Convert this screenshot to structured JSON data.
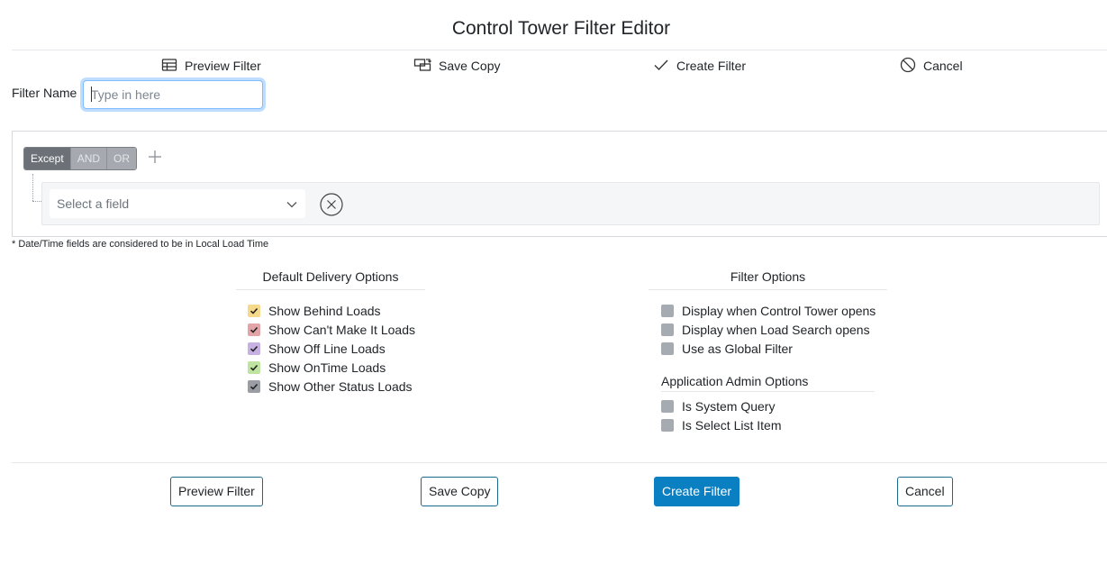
{
  "title": "Control Tower Filter Editor",
  "toolbar": {
    "preview": {
      "label": "Preview Filter",
      "icon": "table-icon"
    },
    "save_copy": {
      "label": "Save Copy",
      "icon": "copy-arrows-icon"
    },
    "create": {
      "label": "Create Filter",
      "icon": "checkmark-icon"
    },
    "cancel": {
      "label": "Cancel",
      "icon": "ban-icon"
    }
  },
  "filter_name": {
    "label": "Filter Name",
    "value": "",
    "placeholder": "Type in here"
  },
  "query_builder": {
    "group_buttons": [
      "Except",
      "AND",
      "OR"
    ],
    "active_group": "Except",
    "add_icon": "plus-icon",
    "rule": {
      "field_placeholder": "Select a field",
      "remove_icon": "circle-x-icon"
    }
  },
  "note": "* Date/Time fields are considered to be in Local Load Time",
  "delivery_options": {
    "title": "Default Delivery Options",
    "items": [
      {
        "label": "Show Behind Loads",
        "checked": true,
        "color": "#f6d98a"
      },
      {
        "label": "Show Can't Make It Loads",
        "checked": true,
        "color": "#e2a4a6"
      },
      {
        "label": "Show Off Line Loads",
        "checked": true,
        "color": "#c7b1e3"
      },
      {
        "label": "Show OnTime Loads",
        "checked": true,
        "color": "#bfe3a0"
      },
      {
        "label": "Show Other Status Loads",
        "checked": true,
        "color": "#9a9ea4"
      }
    ]
  },
  "filter_options": {
    "title": "Filter Options",
    "items": [
      {
        "label": "Display when Control Tower opens",
        "checked": false
      },
      {
        "label": "Display when Load Search opens",
        "checked": false
      },
      {
        "label": "Use as Global Filter",
        "checked": false
      }
    ]
  },
  "admin_options": {
    "title": "Application Admin Options",
    "items": [
      {
        "label": "Is System Query",
        "checked": false
      },
      {
        "label": "Is Select List Item",
        "checked": false
      }
    ]
  },
  "footer": {
    "preview": "Preview Filter",
    "save_copy": "Save Copy",
    "create": "Create Filter",
    "cancel": "Cancel"
  }
}
